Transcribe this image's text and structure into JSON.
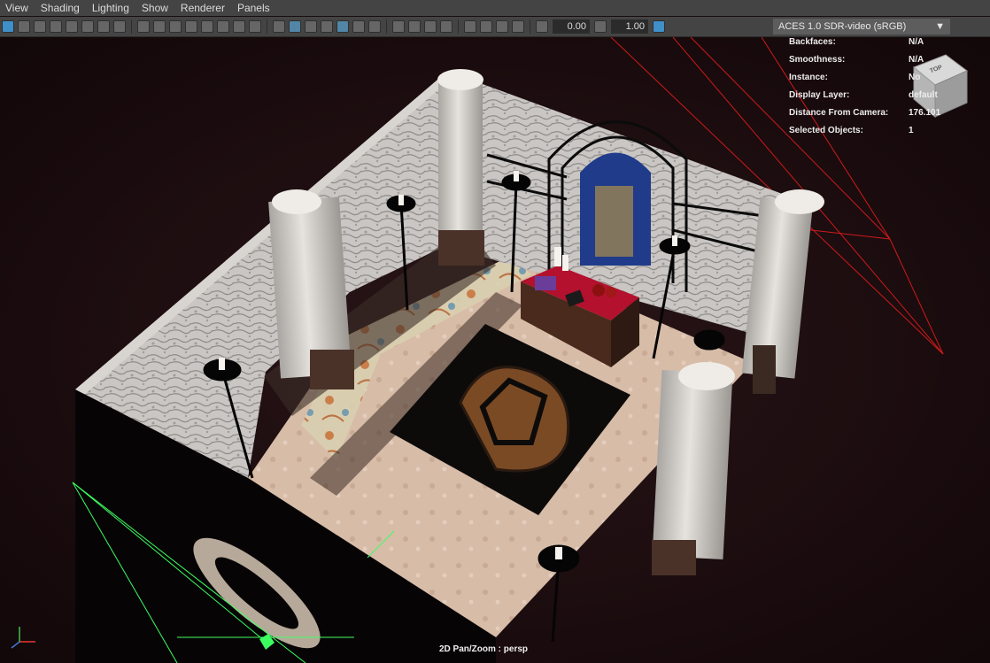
{
  "menubar": {
    "items": [
      "View",
      "Shading",
      "Lighting",
      "Show",
      "Renderer",
      "Panels"
    ]
  },
  "toolbar": {
    "exposure": "0.00",
    "gamma": "1.00",
    "color_transform": "ACES 1.0 SDR-video (sRGB)"
  },
  "hud": {
    "rows": [
      {
        "label": "Backfaces:",
        "value": "N/A"
      },
      {
        "label": "Smoothness:",
        "value": "N/A"
      },
      {
        "label": "Instance:",
        "value": "No"
      },
      {
        "label": "Display Layer:",
        "value": "default"
      },
      {
        "label": "Distance From Camera:",
        "value": "176.101"
      },
      {
        "label": "Selected Objects:",
        "value": "1"
      }
    ]
  },
  "viewcube": {
    "face": "TOP"
  },
  "status": {
    "pan_zoom": "2D Pan/Zoom : persp"
  },
  "colors": {
    "ui_bg": "#444444",
    "viewport_bg": "#1a0c0e",
    "highlight": "#5285a6",
    "selection": "#3cff60"
  }
}
